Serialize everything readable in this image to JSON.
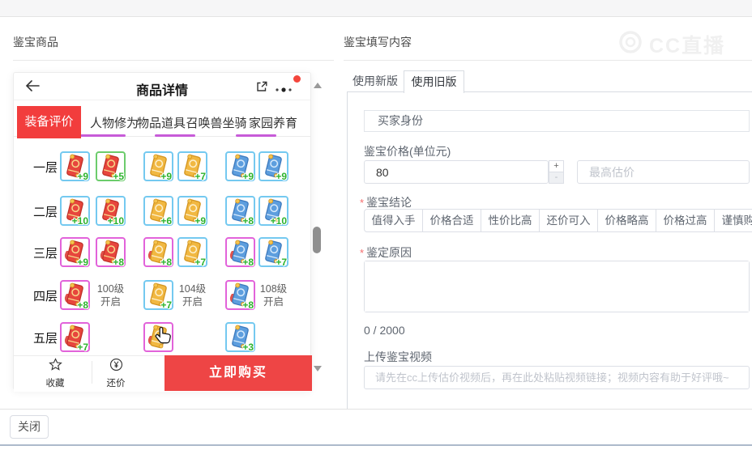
{
  "header": {
    "left_title": "鉴宝商品",
    "right_title": "鉴宝填写内容",
    "watermark": "CC直播"
  },
  "product_card": {
    "title": "商品详情",
    "tabs": [
      {
        "label": "装备评价",
        "active": true
      },
      {
        "label": "人物修为",
        "active": false
      },
      {
        "label": "物品道具",
        "active": false
      },
      {
        "label": "召唤兽坐骑",
        "active": false
      },
      {
        "label": "家园养育",
        "active": false
      }
    ],
    "rows": [
      {
        "label": "一层",
        "cells": [
          {
            "type": "item",
            "card": "red",
            "border": "cyan",
            "plus": "+9"
          },
          {
            "type": "item",
            "card": "red",
            "border": "green",
            "plus": "+5"
          },
          {
            "type": "item",
            "card": "gold",
            "border": "cyan",
            "plus": "+9"
          },
          {
            "type": "item",
            "card": "gold",
            "border": "cyan",
            "plus": "+7"
          },
          {
            "type": "item",
            "card": "blue",
            "border": "cyan",
            "plus": "+9"
          },
          {
            "type": "item",
            "card": "blue",
            "border": "cyan",
            "plus": "+9"
          }
        ]
      },
      {
        "label": "二层",
        "cells": [
          {
            "type": "item",
            "card": "red",
            "border": "cyan",
            "plus": "+10"
          },
          {
            "type": "item",
            "card": "red",
            "border": "cyan",
            "plus": "+10"
          },
          {
            "type": "item",
            "card": "gold",
            "border": "cyan",
            "plus": "+6"
          },
          {
            "type": "item",
            "card": "gold",
            "border": "cyan",
            "plus": "+9"
          },
          {
            "type": "item",
            "card": "blue",
            "border": "cyan",
            "plus": "+8"
          },
          {
            "type": "item",
            "card": "blue",
            "border": "cyan",
            "plus": "+10"
          }
        ]
      },
      {
        "label": "三层",
        "cells": [
          {
            "type": "item",
            "card": "red",
            "border": "magenta",
            "plus": "+9",
            "tassel": true
          },
          {
            "type": "item",
            "card": "red",
            "border": "magenta",
            "plus": "+8",
            "tassel": true
          },
          {
            "type": "item",
            "card": "gold",
            "border": "magenta",
            "plus": "+8",
            "tassel": true
          },
          {
            "type": "item",
            "card": "gold",
            "border": "cyan",
            "plus": "+7"
          },
          {
            "type": "item",
            "card": "blue",
            "border": "magenta",
            "plus": "+8",
            "tassel": true
          },
          {
            "type": "item",
            "card": "blue",
            "border": "cyan",
            "plus": "+7"
          }
        ]
      },
      {
        "label": "四层",
        "cells": [
          {
            "type": "item",
            "card": "red",
            "border": "magenta",
            "plus": "+8",
            "tassel": true
          },
          {
            "type": "text",
            "lines": [
              "100级",
              "开启"
            ]
          },
          {
            "type": "item",
            "card": "gold",
            "border": "cyan",
            "plus": "+7"
          },
          {
            "type": "text",
            "lines": [
              "104级",
              "开启"
            ]
          },
          {
            "type": "item",
            "card": "blue",
            "border": "magenta",
            "plus": "+8",
            "tassel": true
          },
          {
            "type": "text",
            "lines": [
              "108级",
              "开启"
            ]
          }
        ]
      },
      {
        "label": "五层",
        "cells": [
          {
            "type": "item",
            "card": "red",
            "border": "magenta",
            "plus": "+7",
            "tassel": true
          },
          {
            "type": "empty"
          },
          {
            "type": "item",
            "card": "gold",
            "border": "magenta",
            "plus": "",
            "tassel": true,
            "cursor": true
          },
          {
            "type": "empty"
          },
          {
            "type": "item",
            "card": "blue",
            "border": "cyan",
            "plus": "+3"
          },
          {
            "type": "empty"
          }
        ]
      }
    ],
    "actions": {
      "favorite": "收藏",
      "bargain": "还价",
      "buy": "立即购买"
    },
    "item_palettes": {
      "red": {
        "main": "#e7463d",
        "dark": "#c03028",
        "pattern": "#f7d98a"
      },
      "gold": {
        "main": "#f1b842",
        "dark": "#d3941f",
        "pattern": "#fdf0cd"
      },
      "blue": {
        "main": "#5d9ede",
        "dark": "#3c79bd",
        "pattern": "#d6e9fb"
      }
    }
  },
  "form": {
    "tab_new": "使用新版",
    "tab_old": "使用旧版",
    "buyer_label": "买家身份",
    "price_label": "鉴宝价格(单位元)",
    "price_value": "80",
    "stepper_up": "+",
    "stepper_down": "-",
    "max_placeholder": "最高估价",
    "conclusion_label": "鉴宝结论",
    "required_mark": "*",
    "conclusions": [
      "值得入手",
      "价格合适",
      "性价比高",
      "还价可入",
      "价格略高",
      "价格过高",
      "谨慎购买"
    ],
    "reason_label": "鉴定原因",
    "counter": "0 / 2000",
    "video_label": "上传鉴宝视频",
    "video_placeholder": "请先在cc上传估价视频后，再在此处粘贴视频链接；视频内容有助于好评哦~"
  },
  "footer": {
    "close": "关闭"
  },
  "colors": {
    "tab_red": "#f23d3d",
    "buy_red": "#ee4545",
    "plus_green": "#2db32d",
    "border_cyan": "#74c9f0",
    "border_magenta": "#e263da",
    "border_green": "#6ccc6c",
    "sliver_purple": "#c75bd8",
    "asterisk_red": "#f56c6c"
  }
}
